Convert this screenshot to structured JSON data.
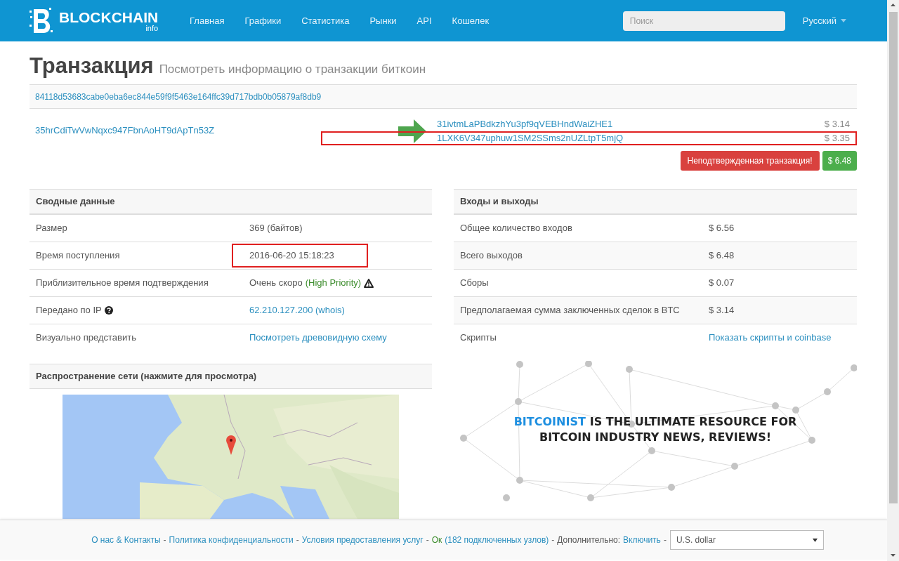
{
  "navbar": {
    "brand": "BLOCKCHAIN",
    "brand_sub": "info",
    "links": [
      "Главная",
      "Графики",
      "Статистика",
      "Рынки",
      "API",
      "Кошелек"
    ],
    "search": {
      "placeholder": "Поиск"
    },
    "language": "Русский"
  },
  "heading": {
    "title": "Транзакция",
    "subtitle": "Посмотреть информацию о транзакции биткоин"
  },
  "transaction": {
    "hash": "84118d53683cabe0eba6ec844e59f9f5463e164ffc39d717bdb0b05879af8db9",
    "input": "35hrCdiTwVwNqxc947FbnAoHT9dApTn53Z",
    "outputs": [
      {
        "address": "31ivtmLaPBdkzhYu3pf9qVEBHndWaiZHE1",
        "amount": "$ 3.14",
        "highlighted": false
      },
      {
        "address": "1LXK6V347uphuw1SM2SSms2nUZLtpT5mjQ",
        "amount": "$ 3.35",
        "highlighted": true
      }
    ],
    "status": "Неподтвержденная транзакция!",
    "total": "$ 6.48"
  },
  "summary": {
    "title": "Сводные данные",
    "rows": [
      {
        "label": "Размер",
        "kind": "text",
        "value": "369 (байтов)",
        "help": false,
        "highlighted": false
      },
      {
        "label": "Время поступления",
        "kind": "text",
        "value": "2016-06-20 15:18:23",
        "help": false,
        "highlighted": true
      },
      {
        "label": "Приблизительное время подтверждения",
        "kind": "priority",
        "value": "Очень скоро",
        "note": "(High Priority)",
        "help": false,
        "highlighted": false
      },
      {
        "label": "Передано по IP",
        "kind": "link",
        "value": "62.210.127.200 (whois)",
        "help": true,
        "highlighted": false
      },
      {
        "label": "Визуально представить",
        "kind": "link",
        "value": "Посмотреть древовидную схему",
        "help": false,
        "highlighted": false
      }
    ]
  },
  "inputs_outputs": {
    "title": "Входы и выходы",
    "rows": [
      {
        "label": "Общее количество входов",
        "kind": "text",
        "value": "$ 6.56"
      },
      {
        "label": "Всего выходов",
        "kind": "text",
        "value": "$ 6.48"
      },
      {
        "label": "Сборы",
        "kind": "text",
        "value": "$ 0.07"
      },
      {
        "label": "Предполагаемая сумма заключенных сделок в BTC",
        "kind": "text",
        "value": "$ 3.14"
      },
      {
        "label": "Скрипты",
        "kind": "link",
        "value": "Показать скрипты и coinbase"
      }
    ]
  },
  "network": {
    "title": "Распространение сети (нажмите для просмотра)"
  },
  "ad": {
    "brand": "BITCOINIST",
    "lines": [
      "IS THE ULTIMATE RESOURCE FOR",
      "BITCOIN INDUSTRY NEWS, REVIEWS!"
    ]
  },
  "footer": {
    "separator": "-",
    "items": [
      {
        "kind": "link",
        "text": "О нас & Контакты"
      },
      {
        "kind": "link",
        "text": "Политика конфиденциальности"
      },
      {
        "kind": "link",
        "text": "Условия предоставления услуг"
      },
      {
        "kind": "status",
        "text": "Ок",
        "detail": "(182 подключенных узлов)"
      },
      {
        "kind": "option",
        "text": "Дополнительно:",
        "link": "Включить"
      }
    ],
    "currency": "U.S. dollar"
  }
}
